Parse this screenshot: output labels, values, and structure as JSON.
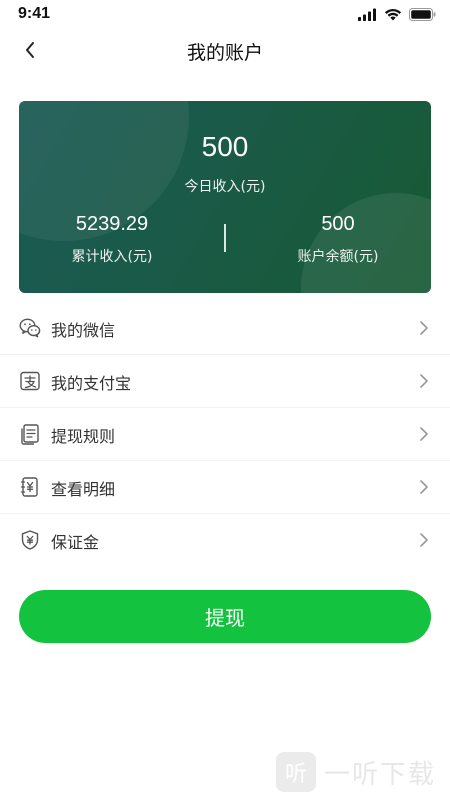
{
  "status_bar": {
    "time": "9:41"
  },
  "nav": {
    "title": "我的账户"
  },
  "card": {
    "today_income": "500",
    "today_income_label": "今日收入(元)",
    "total_income": "5239.29",
    "total_income_label": "累计收入(元)",
    "balance": "500",
    "balance_label": "账户余额(元)",
    "colors": {
      "start": "#1c5a55",
      "end": "#175a33"
    }
  },
  "menu": {
    "items": [
      {
        "label": "我的微信",
        "icon": "wechat-icon"
      },
      {
        "label": "我的支付宝",
        "icon": "alipay-icon"
      },
      {
        "label": "提现规则",
        "icon": "rules-document-icon"
      },
      {
        "label": "查看明细",
        "icon": "details-receipt-icon"
      },
      {
        "label": "保证金",
        "icon": "deposit-shield-icon"
      }
    ]
  },
  "withdraw_button": {
    "label": "提现",
    "color": "#13c23f"
  },
  "watermark": {
    "logo_char": "听",
    "text": "一听下载"
  }
}
